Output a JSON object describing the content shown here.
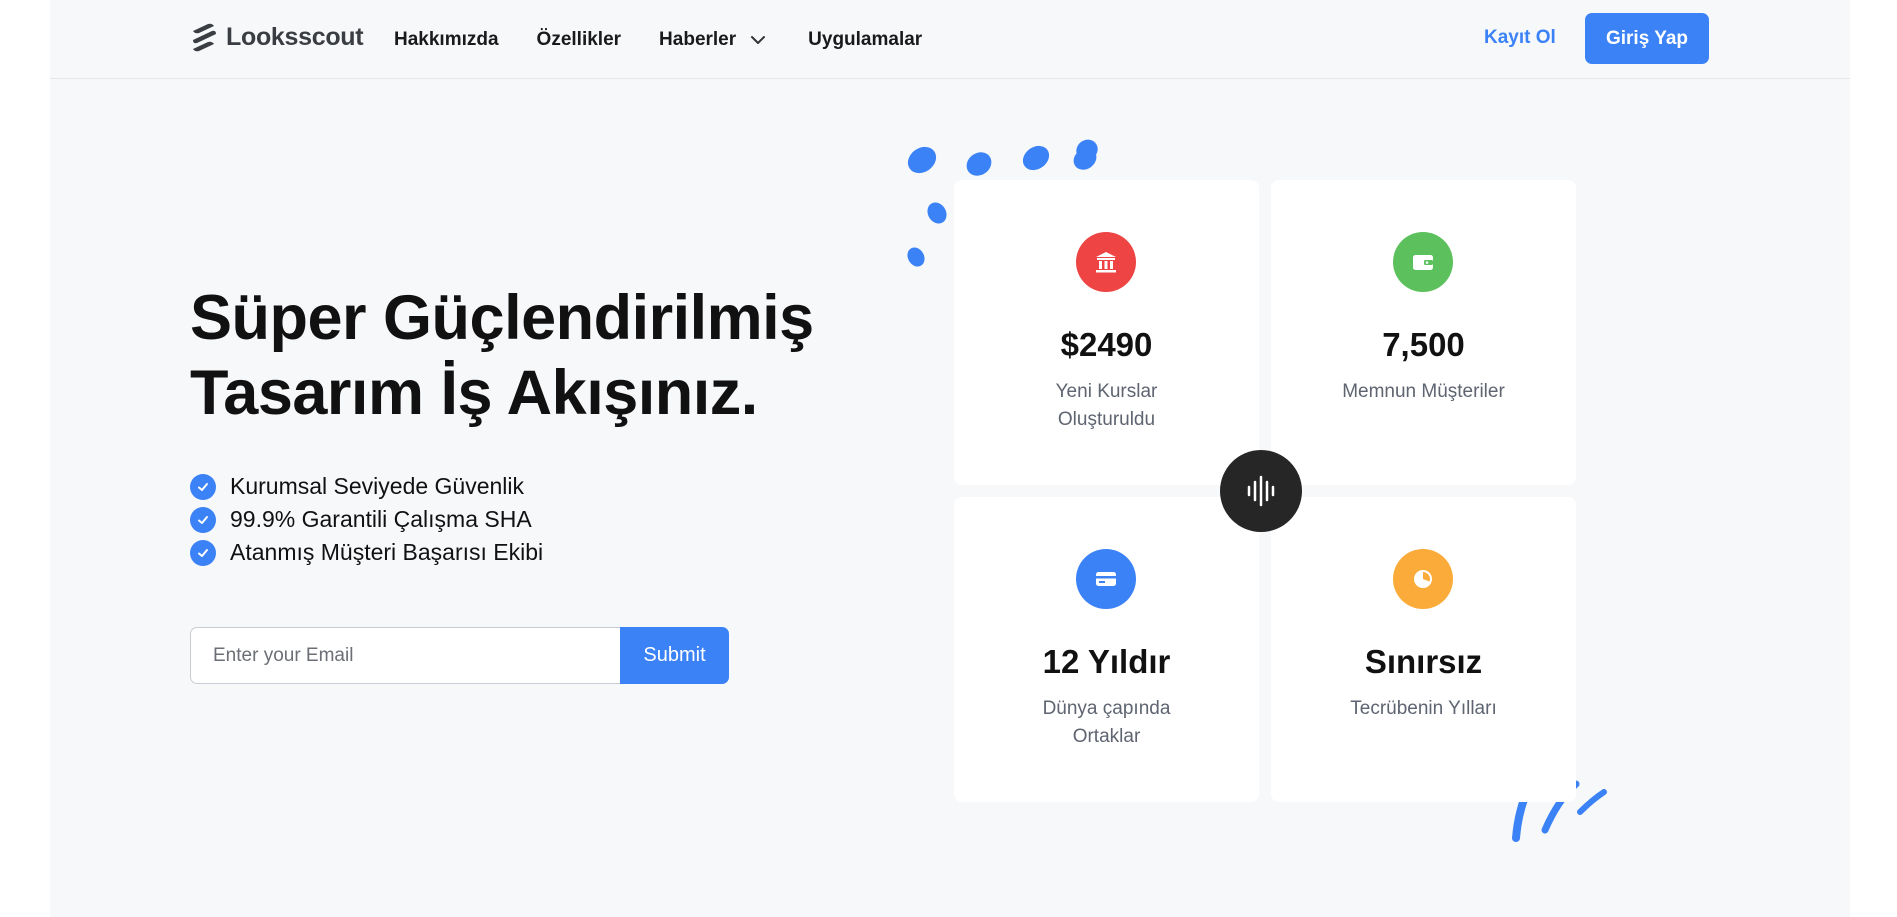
{
  "brand": {
    "name": "Looksscout",
    "accent": "#3b82f6"
  },
  "header": {
    "nav": [
      {
        "label": "Hakkımızda"
      },
      {
        "label": "Özellikler"
      },
      {
        "label": "Haberler",
        "has_dropdown": true
      },
      {
        "label": "Uygulamalar"
      }
    ],
    "signup_label": "Kayıt Ol",
    "login_label": "Giriş Yap"
  },
  "hero": {
    "title_line1": "Süper Güçlendirilmiş",
    "title_line2": "Tasarım İş Akışınız.",
    "features": [
      "Kurumsal Seviyede Güvenlik",
      "99.9% Garantili Çalışma SHA",
      "Atanmış Müşteri Başarısı Ekibi"
    ],
    "email_placeholder": "Enter your Email",
    "submit_label": "Submit"
  },
  "stats": [
    {
      "value": "$2490",
      "label": "Yeni Kurslar Oluşturuldu",
      "icon": "bank-icon",
      "color": "#ef4444"
    },
    {
      "value": "7,500",
      "label": "Memnun Müşteriler",
      "icon": "wallet-icon",
      "color": "#5cc15c"
    },
    {
      "value": "12 Yıldır",
      "label": "Dünya çapında Ortaklar",
      "icon": "credit-card-icon",
      "color": "#3b82f6"
    },
    {
      "value": "Sınırsız",
      "label": "Tecrübenin Yılları",
      "icon": "pie-chart-icon",
      "color": "#fbab3a"
    }
  ],
  "center_badge_icon": "soundwave-icon"
}
